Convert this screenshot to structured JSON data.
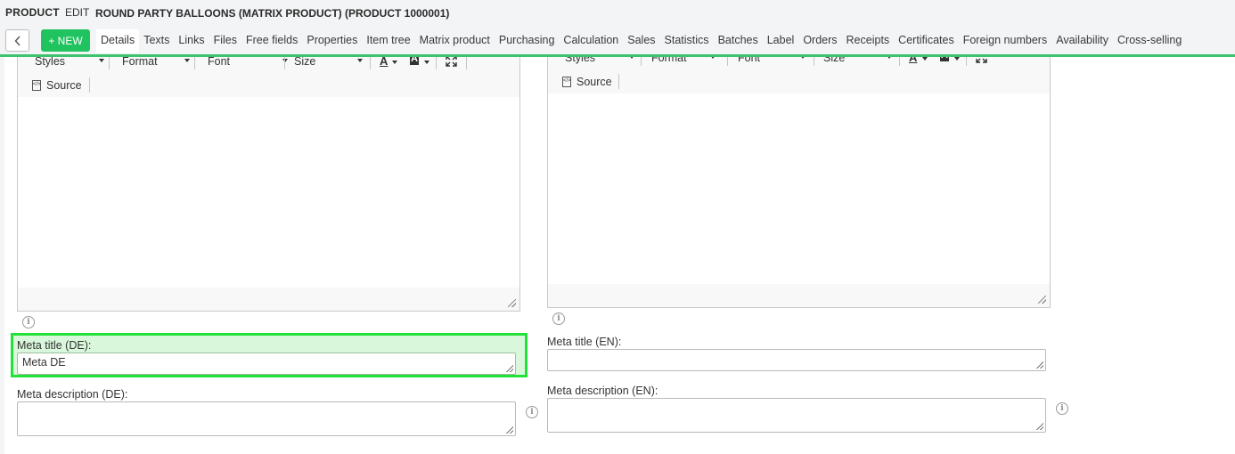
{
  "header": {
    "section": "PRODUCT",
    "mode": "EDIT",
    "product_name": "ROUND PARTY BALLOONS (MATRIX PRODUCT) (PRODUCT 1000001)"
  },
  "toolbar": {
    "back_icon": "chevron-left-icon",
    "new_label": "+ NEW"
  },
  "tabs": [
    {
      "label": "Details",
      "active": true
    },
    {
      "label": "Texts"
    },
    {
      "label": "Links"
    },
    {
      "label": "Files"
    },
    {
      "label": "Free fields"
    },
    {
      "label": "Properties"
    },
    {
      "label": "Item tree"
    },
    {
      "label": "Matrix product"
    },
    {
      "label": "Purchasing"
    },
    {
      "label": "Calculation"
    },
    {
      "label": "Sales"
    },
    {
      "label": "Statistics"
    },
    {
      "label": "Batches"
    },
    {
      "label": "Label"
    },
    {
      "label": "Orders"
    },
    {
      "label": "Receipts"
    },
    {
      "label": "Certificates"
    },
    {
      "label": "Foreign numbers"
    },
    {
      "label": "Availability"
    },
    {
      "label": "Cross-selling"
    }
  ],
  "editor_toolbar": {
    "styles": "Styles",
    "format": "Format",
    "font": "Font",
    "size": "Size",
    "text_color_icon": "A",
    "bg_color_icon": "A",
    "maximize_icon": "maximize-icon",
    "source": "Source"
  },
  "fields_de": {
    "meta_title_label": "Meta title (DE):",
    "meta_title_value": "Meta DE",
    "meta_description_label": "Meta description (DE):",
    "meta_description_value": ""
  },
  "fields_en": {
    "meta_title_label": "Meta title (EN):",
    "meta_title_value": "",
    "meta_description_label": "Meta description (EN):",
    "meta_description_value": ""
  },
  "colors": {
    "accent_green": "#20c35f",
    "highlight_border": "#22e23a",
    "highlight_fill": "#d9f7da"
  }
}
